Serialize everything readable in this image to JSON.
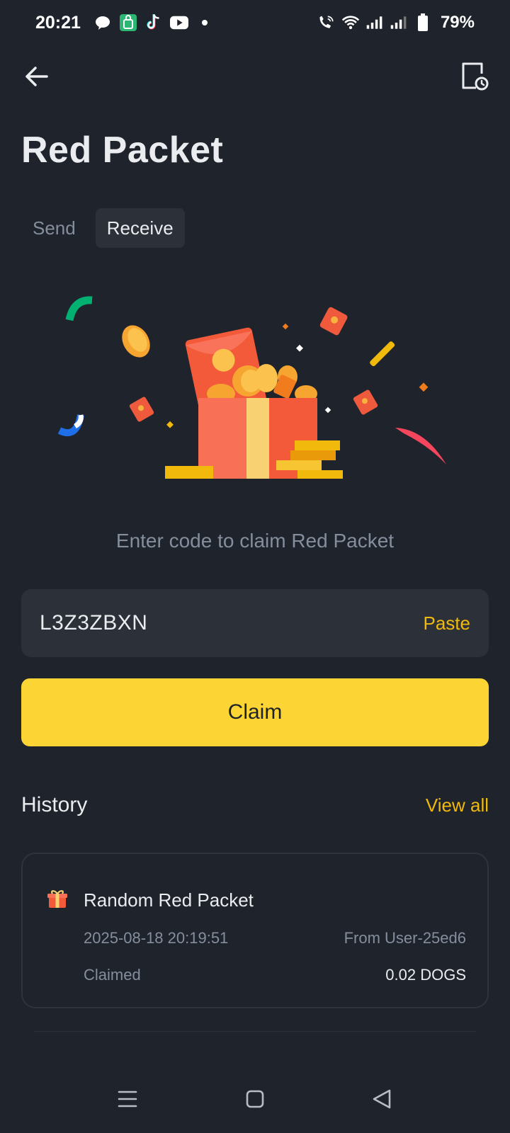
{
  "status_bar": {
    "time": "20:21",
    "battery": "79%",
    "icons": [
      "chat-bubble-icon",
      "shop-icon",
      "tiktok-icon",
      "youtube-icon",
      "dot-icon",
      "wifi-call-icon",
      "wifi-icon",
      "signal-icon",
      "signal-icon",
      "battery-icon"
    ]
  },
  "nav": {
    "back_icon": "arrow-left-icon",
    "history_icon": "document-clock-icon"
  },
  "page": {
    "title": "Red Packet"
  },
  "tabs": [
    {
      "label": "Send",
      "active": false
    },
    {
      "label": "Receive",
      "active": true
    }
  ],
  "receive": {
    "prompt": "Enter code to claim Red Packet",
    "code_value": "L3Z3ZBXN",
    "paste_label": "Paste",
    "claim_label": "Claim"
  },
  "history": {
    "title": "History",
    "view_all_label": "View all",
    "items": [
      {
        "title": "Random Red Packet",
        "date": "2025-08-18 20:19:51",
        "from": "From User-25ed6",
        "status": "Claimed",
        "amount": "0.02 DOGS"
      }
    ]
  },
  "colors": {
    "background": "#1f232c",
    "surface": "#2b3039",
    "accent": "#f0b90b",
    "button": "#fcd535",
    "muted_text": "#848e9c",
    "primary_text": "#eaecef"
  }
}
